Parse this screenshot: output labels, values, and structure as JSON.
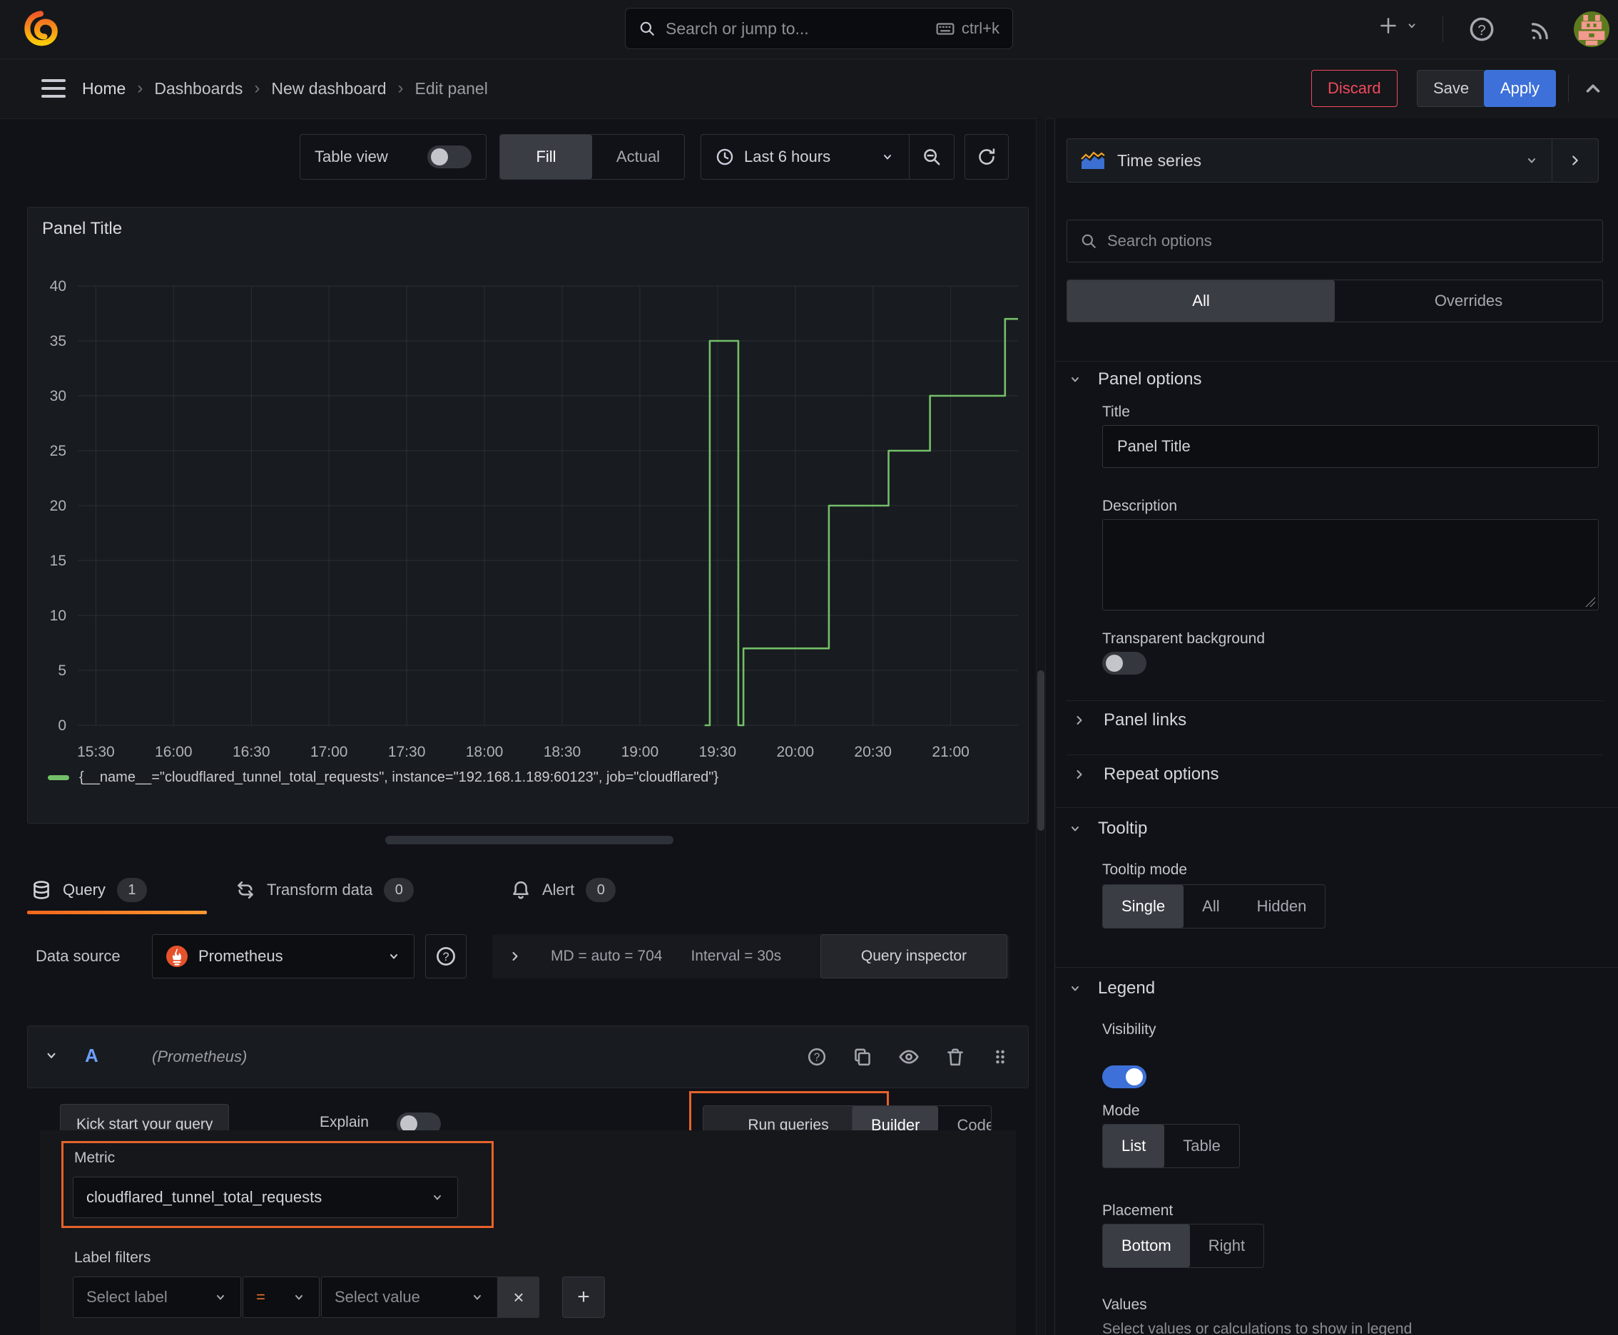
{
  "topnav": {
    "search_placeholder": "Search or jump to...",
    "search_shortcut": "ctrl+k"
  },
  "breadcrumb": {
    "items": [
      "Home",
      "Dashboards",
      "New dashboard",
      "Edit panel"
    ],
    "separator": "›"
  },
  "header_actions": {
    "discard": "Discard",
    "save": "Save",
    "apply": "Apply"
  },
  "view_toolbar": {
    "table_view_label": "Table view",
    "fill_label": "Fill",
    "actual_label": "Actual",
    "time_range_label": "Last 6 hours"
  },
  "panel": {
    "title": "Panel Title"
  },
  "chart_data": {
    "type": "line",
    "title": "Panel Title",
    "x_ticks": [
      "15:30",
      "16:00",
      "16:30",
      "17:00",
      "17:30",
      "18:00",
      "18:30",
      "19:00",
      "19:30",
      "20:00",
      "20:30",
      "21:00"
    ],
    "y_ticks": [
      0,
      5,
      10,
      15,
      20,
      25,
      30,
      35,
      40
    ],
    "ylim": [
      0,
      40
    ],
    "x_range_minutes": [
      "15:23",
      "21:26"
    ],
    "grid": true,
    "legend_position": "bottom",
    "series": [
      {
        "name": "{__name__=\"cloudflared_tunnel_total_requests\", instance=\"192.168.1.189:60123\", job=\"cloudflared\"}",
        "color": "#73bf69",
        "line_style": "step",
        "points": [
          [
            "19:25",
            0
          ],
          [
            "19:27",
            0
          ],
          [
            "19:27",
            35
          ],
          [
            "19:38",
            35
          ],
          [
            "19:38",
            0
          ],
          [
            "19:40",
            0
          ],
          [
            "19:40",
            7
          ],
          [
            "20:13",
            7
          ],
          [
            "20:13",
            20
          ],
          [
            "20:36",
            20
          ],
          [
            "20:36",
            25
          ],
          [
            "20:52",
            25
          ],
          [
            "20:52",
            30
          ],
          [
            "21:21",
            30
          ],
          [
            "21:21",
            37
          ],
          [
            "21:26",
            37
          ]
        ]
      }
    ]
  },
  "query_tabs": {
    "query": {
      "label": "Query",
      "count": "1"
    },
    "transform": {
      "label": "Transform data",
      "count": "0"
    },
    "alert": {
      "label": "Alert",
      "count": "0"
    }
  },
  "datasource_bar": {
    "label": "Data source",
    "datasource": "Prometheus",
    "md_stat": "MD = auto = 704",
    "interval_stat": "Interval = 30s",
    "inspector_label": "Query inspector"
  },
  "query_a": {
    "ref_id": "A",
    "hint": "(Prometheus)"
  },
  "query_actions": {
    "kick_start": "Kick start your query",
    "explain": "Explain",
    "run_queries": "Run queries",
    "builder": "Builder",
    "code": "Code"
  },
  "builder_form": {
    "metric_label": "Metric",
    "metric_value": "cloudflared_tunnel_total_requests",
    "label_filters_label": "Label filters",
    "select_label_placeholder": "Select label",
    "operator": "=",
    "select_value_placeholder": "Select value",
    "remove_filter": "×",
    "add_filter": "+"
  },
  "options_pane": {
    "visualization": "Time series",
    "search_placeholder": "Search options",
    "filter_all": "All",
    "filter_overrides": "Overrides",
    "panel_options": {
      "header": "Panel options",
      "title_label": "Title",
      "title_value": "Panel Title",
      "description_label": "Description",
      "transparent_label": "Transparent background"
    },
    "collapsed": {
      "panel_links": "Panel links",
      "repeat_options": "Repeat options"
    },
    "tooltip": {
      "header": "Tooltip",
      "mode_label": "Tooltip mode",
      "mode_single": "Single",
      "mode_all": "All",
      "mode_hidden": "Hidden"
    },
    "legend": {
      "header": "Legend",
      "visibility_label": "Visibility",
      "mode_label": "Mode",
      "mode_list": "List",
      "mode_table": "Table",
      "placement_label": "Placement",
      "placement_bottom": "Bottom",
      "placement_right": "Right",
      "values_label": "Values",
      "values_hint": "Select values or calculations to show in legend"
    }
  },
  "colors": {
    "accent_orange": "#ff780a",
    "annotation_orange": "#e8622a",
    "primary_blue": "#3d71d9",
    "destructive_red": "#f2495c",
    "series_green": "#73bf69",
    "ref_id_blue": "#6e9fff",
    "prometheus_orange": "#e6522c"
  }
}
